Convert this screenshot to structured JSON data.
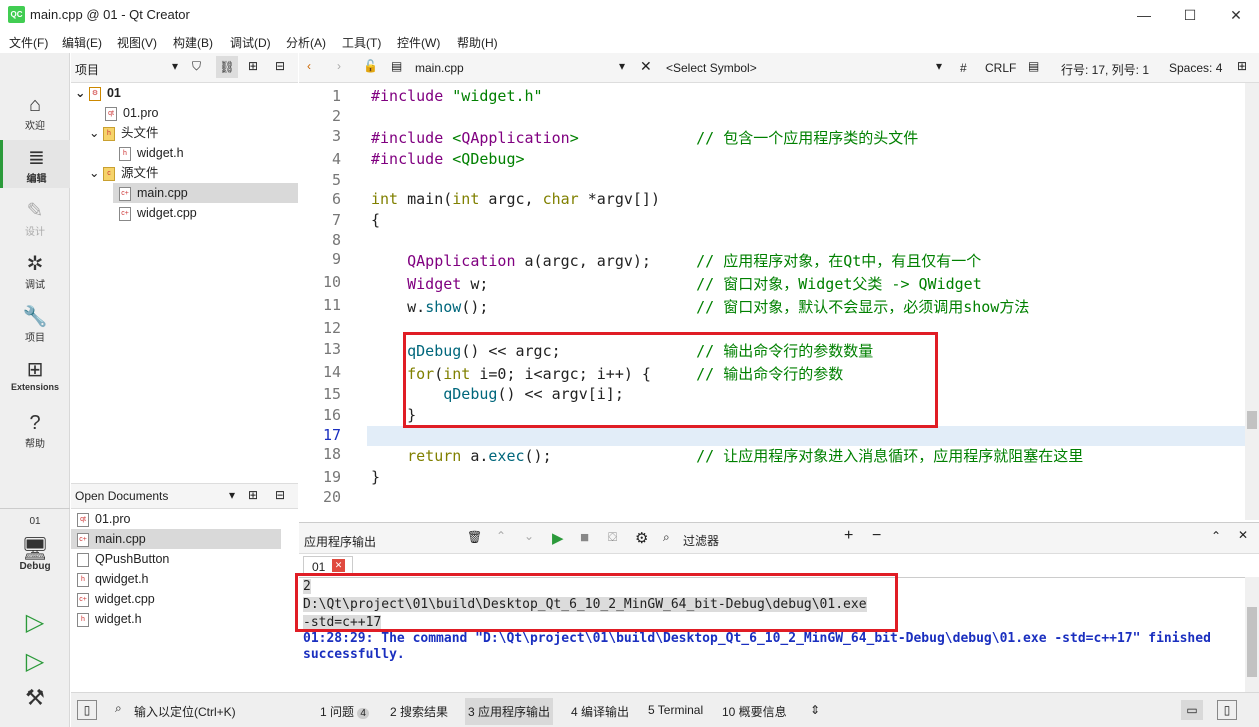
{
  "window": {
    "title": "main.cpp @ 01 - Qt Creator",
    "icon": "QC",
    "min": "—",
    "max": "☐",
    "close": "✕"
  },
  "menu": [
    "文件(F)",
    "编辑(E)",
    "视图(V)",
    "构建(B)",
    "调试(D)",
    "分析(A)",
    "工具(T)",
    "控件(W)",
    "帮助(H)"
  ],
  "modes": [
    {
      "label": "欢迎",
      "icon": "⌂"
    },
    {
      "label": "编辑",
      "icon": "≣"
    },
    {
      "label": "设计",
      "icon": "✎"
    },
    {
      "label": "调试",
      "icon": "✲"
    },
    {
      "label": "项目",
      "icon": "🔧"
    },
    {
      "label": "Extensions",
      "icon": "⊞"
    },
    {
      "label": "帮助",
      "icon": "?"
    }
  ],
  "kit": {
    "project": "01",
    "label": "Debug"
  },
  "project_panel": {
    "title": "项目",
    "tree": [
      {
        "label": "01",
        "level": 0,
        "bold": true
      },
      {
        "label": "01.pro",
        "level": 1
      },
      {
        "label": "头文件",
        "level": 1,
        "folder": true
      },
      {
        "label": "widget.h",
        "level": 2
      },
      {
        "label": "源文件",
        "level": 1,
        "folder": true
      },
      {
        "label": "main.cpp",
        "level": 2,
        "selected": true
      },
      {
        "label": "widget.cpp",
        "level": 2
      }
    ]
  },
  "open_documents": {
    "title": "Open Documents",
    "items": [
      "01.pro",
      "main.cpp",
      "QPushButton",
      "qwidget.h",
      "widget.cpp",
      "widget.h"
    ],
    "selected": 1
  },
  "editor": {
    "file": "main.cpp",
    "symbol": "<Select Symbol>",
    "hash": "#",
    "eol": "CRLF",
    "position": "行号: 17, 列号: 1",
    "spaces": "Spaces: 4"
  },
  "code": [
    {
      "n": "1",
      "t": "#include \"widget.h\""
    },
    {
      "n": "2",
      "t": ""
    },
    {
      "n": "3",
      "t": "#include <QApplication>             // 包含一个应用程序类的头文件"
    },
    {
      "n": "4",
      "t": "#include <QDebug>"
    },
    {
      "n": "5",
      "t": ""
    },
    {
      "n": "6",
      "t": "int main(int argc, char *argv[])"
    },
    {
      "n": "7",
      "t": "{"
    },
    {
      "n": "8",
      "t": ""
    },
    {
      "n": "9",
      "t": "    QApplication a(argc, argv);     // 应用程序对象，在Qt中，有且仅有一个"
    },
    {
      "n": "10",
      "t": "    Widget w;                       // 窗口对象，Widget父类 -> QWidget"
    },
    {
      "n": "11",
      "t": "    w.show();                       // 窗口对象，默认不会显示，必须调用show方法"
    },
    {
      "n": "12",
      "t": ""
    },
    {
      "n": "13",
      "t": "    qDebug() << argc;               // 输出命令行的参数数量"
    },
    {
      "n": "14",
      "t": "    for(int i=0; i<argc; i++) {     // 输出命令行的参数"
    },
    {
      "n": "15",
      "t": "        qDebug() << argv[i];"
    },
    {
      "n": "16",
      "t": "    }"
    },
    {
      "n": "17",
      "t": ""
    },
    {
      "n": "18",
      "t": "    return a.exec();                // 让应用程序对象进入消息循环，应用程序就阻塞在这里"
    },
    {
      "n": "19",
      "t": "}"
    },
    {
      "n": "20",
      "t": ""
    }
  ],
  "output": {
    "title": "应用程序输出",
    "filter": "过滤器",
    "tab": "01",
    "lines": [
      "2",
      "D:\\Qt\\project\\01\\build\\Desktop_Qt_6_10_2_MinGW_64_bit-Debug\\debug\\01.exe",
      "-std=c++17",
      "01:28:29: The command \"D:\\Qt\\project\\01\\build\\Desktop_Qt_6_10_2_MinGW_64_bit-Debug\\debug\\01.exe -std=c++17\" finished",
      "successfully."
    ]
  },
  "status": {
    "locate": "输入以定位(Ctrl+K)",
    "tabs": [
      "1  问题",
      "2  搜索结果",
      "3  应用程序输出",
      "4  编译输出",
      "5  Terminal",
      "10  概要信息"
    ],
    "problems_count": "4"
  },
  "colors": {
    "accent": "#2b9a3a",
    "highlight_box": "#e01d25",
    "current_line": "#e2edf8"
  }
}
